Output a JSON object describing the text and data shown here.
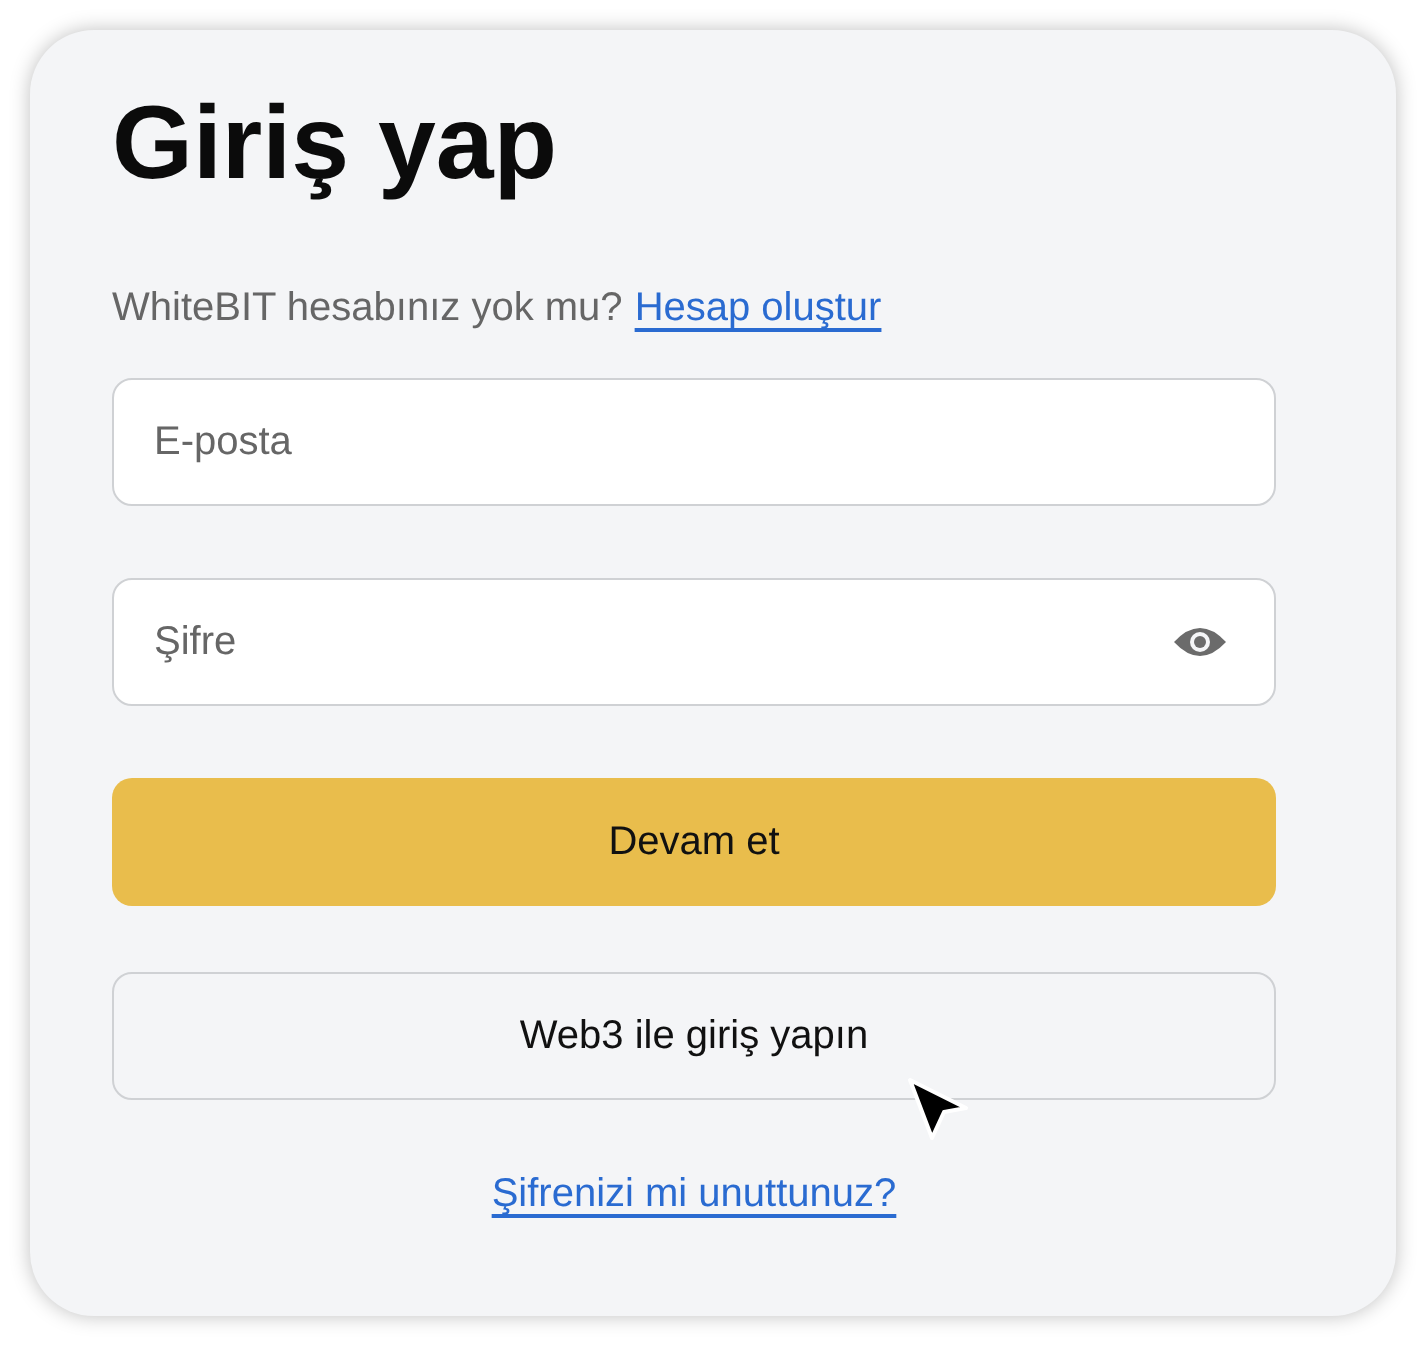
{
  "title": "Giriş yap",
  "signup": {
    "text": "WhiteBIT hesabınız yok mu?",
    "link": "Hesap oluştur"
  },
  "fields": [
    {
      "placeholder": "E-posta",
      "kind": "text"
    },
    {
      "placeholder": "Şifre",
      "kind": "password"
    }
  ],
  "buttons": [
    {
      "label": "Devam et",
      "kind": "primary"
    },
    {
      "label": "Web3 ile giriş yapın",
      "kind": "secondary"
    }
  ],
  "forgot_link": "Şifrenizi mi unuttunuz?"
}
